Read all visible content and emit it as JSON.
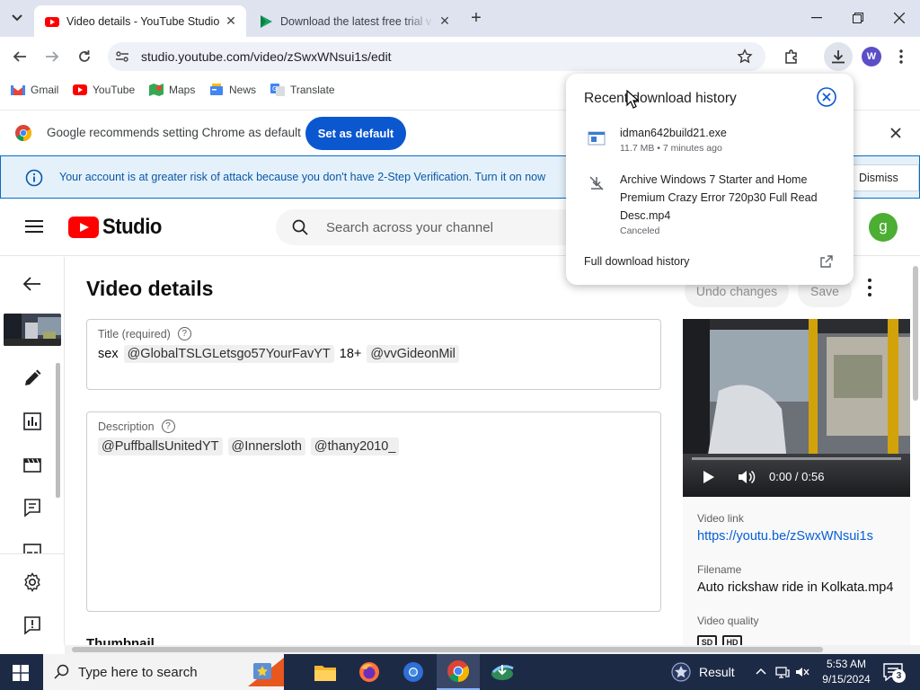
{
  "browser": {
    "tabs": [
      {
        "title": "Video details - YouTube Studio",
        "active": true
      },
      {
        "title": "Download the latest free trial v",
        "active": false
      }
    ],
    "url": "studio.youtube.com/video/zSwxWNsui1s/edit",
    "profile_initial": "W",
    "bookmarks": [
      "Gmail",
      "YouTube",
      "Maps",
      "News",
      "Translate"
    ]
  },
  "default_bar": {
    "message": "Google recommends setting Chrome as default",
    "button": "Set as default"
  },
  "security_banner": {
    "text": "Your account is at greater risk of attack because you don't have 2-Step Verification. Turn it on now",
    "dismiss": "Dismiss"
  },
  "studio": {
    "logo_text": "Studio",
    "search_placeholder": "Search across your channel",
    "avatar_initial": "g"
  },
  "page": {
    "title": "Video details",
    "undo_label": "Undo changes",
    "save_label": "Save",
    "title_field": {
      "label": "Title (required)",
      "help": "?",
      "tokens": [
        {
          "text": "sex",
          "chip": false
        },
        {
          "text": "@GlobalTSLGLetsgo57YourFavYT",
          "chip": true
        },
        {
          "text": "18+",
          "chip": false
        },
        {
          "text": "@vvGideonMil",
          "chip": true
        }
      ]
    },
    "description_field": {
      "label": "Description",
      "help": "?",
      "tokens": [
        {
          "text": "@PuffballsUnitedYT",
          "chip": true
        },
        {
          "text": "@Innersloth",
          "chip": true
        },
        {
          "text": "@thany2010_",
          "chip": true
        }
      ]
    },
    "thumbnail_heading": "Thumbnail"
  },
  "video_panel": {
    "time": "0:00 / 0:56",
    "video_link_label": "Video link",
    "video_link": "https://youtu.be/zSwxWNsui1s",
    "filename_label": "Filename",
    "filename": "Auto rickshaw ride in Kolkata.mp4",
    "quality_label": "Video quality",
    "quality_badges": [
      "SD",
      "HD"
    ]
  },
  "downloads": {
    "title": "Recent download history",
    "items": [
      {
        "name": "idman642build21.exe",
        "meta": "11.7 MB • 7 minutes ago"
      },
      {
        "name": "Archive Windows 7 Starter and Home Premium Crazy Error 720p30 Full Read Desc.mp4",
        "meta": "Canceled"
      }
    ],
    "full_history": "Full download history"
  },
  "taskbar": {
    "search_placeholder": "Type here to search",
    "weather": "Result",
    "time": "5:53 AM",
    "date": "9/15/2024",
    "notification_count": "3"
  },
  "colors": {
    "accent_blue": "#0b57d0",
    "youtube_red": "#ff0000",
    "banner_blue": "#0a57a6",
    "taskbar": "#1d2a46"
  }
}
